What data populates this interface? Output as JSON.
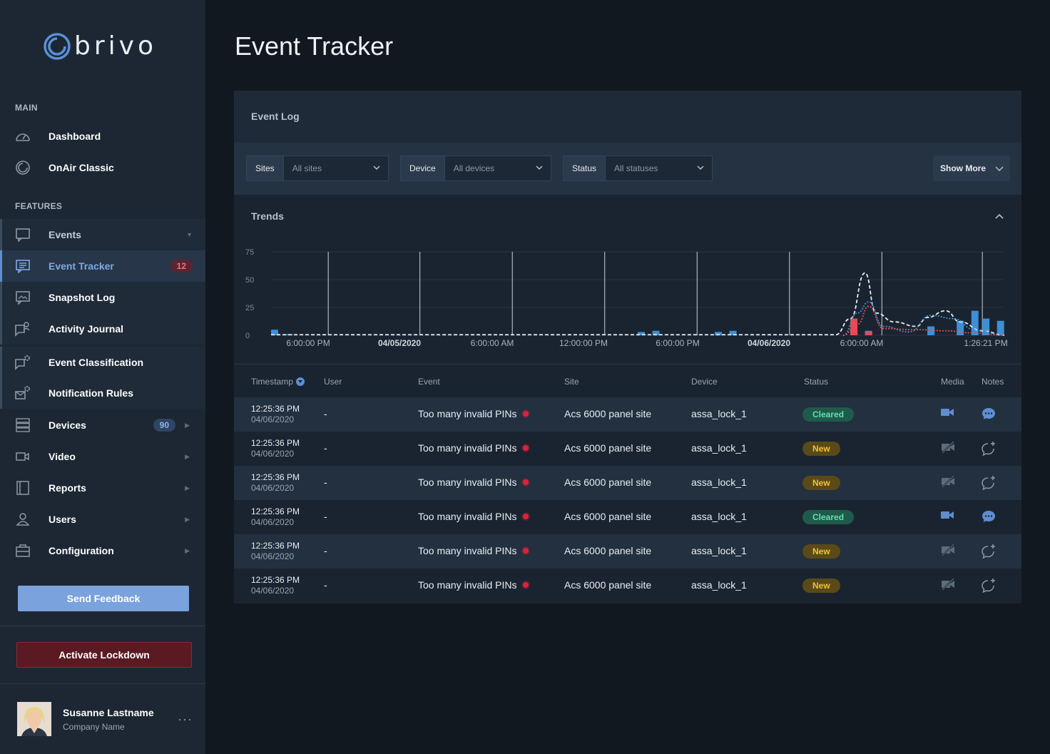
{
  "brand": {
    "name": "brivo"
  },
  "sidebar": {
    "main_title": "MAIN",
    "features_title": "FEATURES",
    "main_items": [
      {
        "label": "Dashboard",
        "icon": "gauge-icon"
      },
      {
        "label": "OnAir Classic",
        "icon": "onair-icon"
      }
    ],
    "feature_items": [
      {
        "label": "Events",
        "icon": "chat-icon"
      },
      {
        "label": "Event Tracker",
        "icon": "list-icon",
        "badge": "12"
      },
      {
        "label": "Snapshot Log",
        "icon": "image-icon"
      },
      {
        "label": "Activity Journal",
        "icon": "journal-icon"
      },
      {
        "label": "Event Classification",
        "icon": "chat-gear-icon"
      },
      {
        "label": "Notification Rules",
        "icon": "mail-gear-icon"
      },
      {
        "label": "Devices",
        "icon": "server-icon",
        "badge": "90"
      },
      {
        "label": "Video",
        "icon": "video-icon"
      },
      {
        "label": "Reports",
        "icon": "book-icon"
      },
      {
        "label": "Users",
        "icon": "user-icon"
      },
      {
        "label": "Configuration",
        "icon": "briefcase-icon"
      }
    ],
    "feedback_label": "Send Feedback",
    "lockdown_label": "Activate Lockdown",
    "user": {
      "name": "Susanne Lastname",
      "company": "Company Name",
      "more": "···"
    }
  },
  "page": {
    "title": "Event Tracker"
  },
  "panel": {
    "title": "Event Log",
    "filters": [
      {
        "label": "Sites",
        "value": "All sites"
      },
      {
        "label": "Device",
        "value": "All devices"
      },
      {
        "label": "Status",
        "value": "All statuses"
      }
    ],
    "show_more": "Show More",
    "trends_title": "Trends"
  },
  "chart_data": {
    "type": "bar",
    "y_ticks": [
      "75",
      "50",
      "25",
      "0"
    ],
    "ylim": [
      0,
      75
    ],
    "x_ticks": [
      "6:00:00 PM",
      "04/05/2020",
      "6:00:00 AM",
      "12:00:00 PM",
      "6:00:00 PM",
      "04/06/2020",
      "6:00:00 AM",
      "1:26:21 PM"
    ],
    "grid": true,
    "series": [
      {
        "kind": "bar",
        "color": "#3d8fd6",
        "points": [
          [
            0.0,
            5
          ],
          [
            0.02,
            1
          ],
          [
            0.5,
            3
          ],
          [
            0.52,
            4
          ],
          [
            0.605,
            3
          ],
          [
            0.625,
            4
          ],
          [
            0.79,
            5
          ],
          [
            0.81,
            4
          ],
          [
            0.895,
            8
          ],
          [
            0.935,
            13
          ],
          [
            0.955,
            22
          ],
          [
            0.97,
            15
          ],
          [
            0.99,
            13
          ]
        ]
      },
      {
        "kind": "bar",
        "color": "#e84a55",
        "points": [
          [
            0.79,
            15
          ],
          [
            0.81,
            3
          ]
        ]
      },
      {
        "kind": "line",
        "style": "dashed",
        "color": "#e8edf2",
        "points": [
          [
            0,
            0.5
          ],
          [
            0.77,
            0.5
          ],
          [
            0.79,
            15
          ],
          [
            0.81,
            56
          ],
          [
            0.825,
            20
          ],
          [
            0.85,
            12
          ],
          [
            0.88,
            8
          ],
          [
            0.895,
            16
          ],
          [
            0.92,
            22
          ],
          [
            0.94,
            12
          ],
          [
            0.97,
            4
          ],
          [
            1.0,
            0
          ]
        ]
      },
      {
        "kind": "line",
        "style": "dotted",
        "color": "#3d8fd6",
        "points": [
          [
            0.78,
            0
          ],
          [
            0.8,
            20
          ],
          [
            0.815,
            30
          ],
          [
            0.835,
            8
          ],
          [
            0.87,
            3
          ],
          [
            0.9,
            18
          ],
          [
            0.93,
            15
          ],
          [
            0.96,
            5
          ],
          [
            1.0,
            0
          ]
        ]
      },
      {
        "kind": "line",
        "style": "dotted",
        "color": "#e84a55",
        "points": [
          [
            0.78,
            0
          ],
          [
            0.8,
            10
          ],
          [
            0.815,
            26
          ],
          [
            0.835,
            6
          ],
          [
            0.88,
            5
          ],
          [
            0.92,
            4
          ],
          [
            0.96,
            2
          ],
          [
            1.0,
            0
          ]
        ]
      }
    ]
  },
  "table": {
    "headers": {
      "timestamp": "Timestamp",
      "user": "User",
      "event": "Event",
      "site": "Site",
      "device": "Device",
      "status": "Status",
      "media": "Media",
      "notes": "Notes"
    },
    "rows": [
      {
        "time": "12:25:36 PM",
        "date": "04/06/2020",
        "user": "-",
        "event": "Too many invalid PINs",
        "site": "Acs 6000 panel site",
        "device": "assa_lock_1",
        "status": "Cleared",
        "media": "video-icon",
        "notes": "comment-icon"
      },
      {
        "time": "12:25:36 PM",
        "date": "04/06/2020",
        "user": "-",
        "event": "Too many invalid PINs",
        "site": "Acs 6000 panel site",
        "device": "assa_lock_1",
        "status": "New",
        "media": "video-off-icon",
        "notes": "add-comment-icon"
      },
      {
        "time": "12:25:36 PM",
        "date": "04/06/2020",
        "user": "-",
        "event": "Too many invalid PINs",
        "site": "Acs 6000 panel site",
        "device": "assa_lock_1",
        "status": "New",
        "media": "video-off-icon",
        "notes": "add-comment-icon"
      },
      {
        "time": "12:25:36 PM",
        "date": "04/06/2020",
        "user": "-",
        "event": "Too many invalid PINs",
        "site": "Acs 6000 panel site",
        "device": "assa_lock_1",
        "status": "Cleared",
        "media": "video-icon",
        "notes": "comment-icon"
      },
      {
        "time": "12:25:36 PM",
        "date": "04/06/2020",
        "user": "-",
        "event": "Too many invalid PINs",
        "site": "Acs 6000 panel site",
        "device": "assa_lock_1",
        "status": "New",
        "media": "video-off-icon",
        "notes": "add-comment-icon"
      },
      {
        "time": "12:25:36 PM",
        "date": "04/06/2020",
        "user": "-",
        "event": "Too many invalid PINs",
        "site": "Acs 6000 panel site",
        "device": "assa_lock_1",
        "status": "New",
        "media": "video-off-icon",
        "notes": "add-comment-icon"
      }
    ]
  }
}
